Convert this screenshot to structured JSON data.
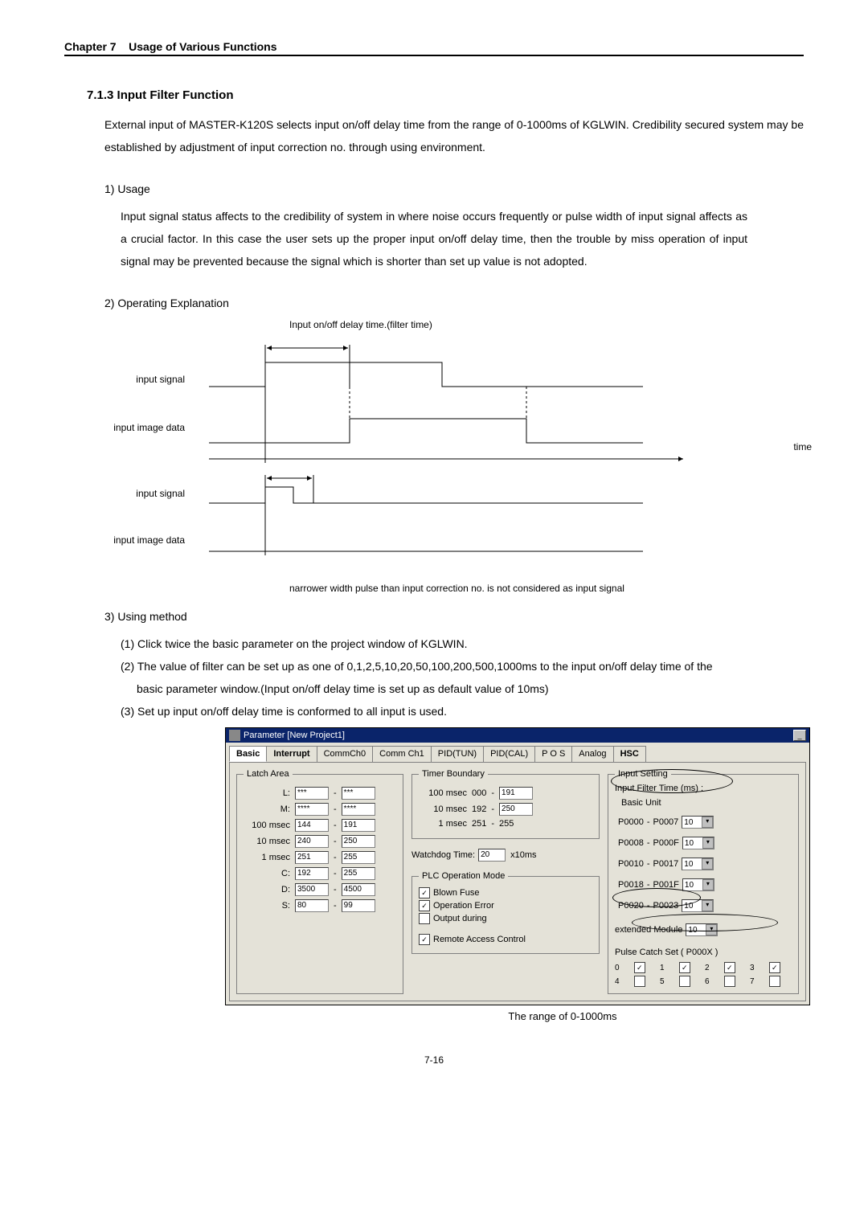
{
  "header": {
    "chapter": "Chapter 7",
    "title": "Usage of Various Functions"
  },
  "section": "7.1.3 Input Filter Function",
  "intro": "External input of MASTER-K120S selects input on/off delay time from the range of 0-1000ms of KGLWIN. Credibility secured system may be established by adjustment of input correction no. through using environment.",
  "usage_head": "1) Usage",
  "usage_body": "Input signal status affects to the credibility of system in where noise occurs frequently or pulse width of input signal affects as a crucial factor. In this case the user sets up the proper input on/off delay time, then the trouble by miss operation of input signal may be prevented because the signal which is shorter than set up value is not adopted.",
  "op_head": "2) Operating Explanation",
  "diagram": {
    "filter_label": "Input on/off delay time.(filter time)",
    "row1": "input    signal",
    "row2": "input image data",
    "row3": "input    signal",
    "row4": "input image data",
    "time": "time",
    "narrow": "narrower width pulse than input correction no. is not considered as input signal"
  },
  "method_head": "3) Using method",
  "method": {
    "m1": "(1) Click twice the basic parameter on the project window of KGLWIN.",
    "m2": "(2) The value of filter can be set up as one of 0,1,2,5,10,20,50,100,200,500,1000ms to the input on/off delay time of the",
    "m2b": "basic parameter window.(Input on/off delay time is set up as default value of 10ms)",
    "m3": "(3) Set up input on/off delay time is conformed to all input is used."
  },
  "dialog": {
    "title": "Parameter [New Project1]",
    "tabs": [
      "Basic",
      "Interrupt",
      "CommCh0",
      "Comm Ch1",
      "PID(TUN)",
      "PID(CAL)",
      "P O S",
      "Analog",
      "HSC"
    ],
    "latch": {
      "legend": "Latch Area",
      "L": {
        "a": "***",
        "b": "***"
      },
      "M": {
        "a": "****",
        "b": "****"
      },
      "t100": {
        "label": "100 msec",
        "a": "144",
        "b": "191"
      },
      "t10": {
        "label": "10 msec",
        "a": "240",
        "b": "250"
      },
      "t1": {
        "label": "1 msec",
        "a": "251",
        "b": "255"
      },
      "C": {
        "a": "192",
        "b": "255"
      },
      "D": {
        "a": "3500",
        "b": "4500"
      },
      "S": {
        "a": "80",
        "b": "99"
      }
    },
    "timer": {
      "legend": "Timer Boundary",
      "t100": {
        "label": "100 msec",
        "a": "000",
        "b": "191"
      },
      "t10": {
        "label": "10 msec",
        "a": "192",
        "b": "250"
      },
      "t1": {
        "label": "1 msec",
        "a": "251",
        "b": "255"
      }
    },
    "watchdog": {
      "label": "Watchdog Time:",
      "val": "20",
      "unit": "x10ms"
    },
    "plc": {
      "legend": "PLC Operation Mode",
      "c1": "Blown Fuse",
      "c2": "Operation Error",
      "c3": "Output during",
      "c4": "Remote Access Control"
    },
    "input": {
      "legend": "Input Setting",
      "filterlabel": "Input Filter Time (ms) :",
      "basic": "Basic Unit",
      "rows": [
        {
          "a": "P0000",
          "b": "P0007",
          "v": "10"
        },
        {
          "a": "P0008",
          "b": "P000F",
          "v": "10"
        },
        {
          "a": "P0010",
          "b": "P0017",
          "v": "10"
        },
        {
          "a": "P0018",
          "b": "P001F",
          "v": "10"
        },
        {
          "a": "P0020",
          "b": "P0023",
          "v": "10"
        }
      ],
      "ext": {
        "label": "extended Module",
        "v": "10"
      },
      "pulse": {
        "label": "Pulse Catch Set ( P000X )",
        "bits": [
          0,
          1,
          2,
          3,
          4,
          5,
          6,
          7
        ],
        "checked": [
          true,
          true,
          true,
          true,
          true,
          false,
          false,
          false,
          false
        ]
      }
    }
  },
  "range_note": "The range of 0-1000ms",
  "page": "7-16"
}
